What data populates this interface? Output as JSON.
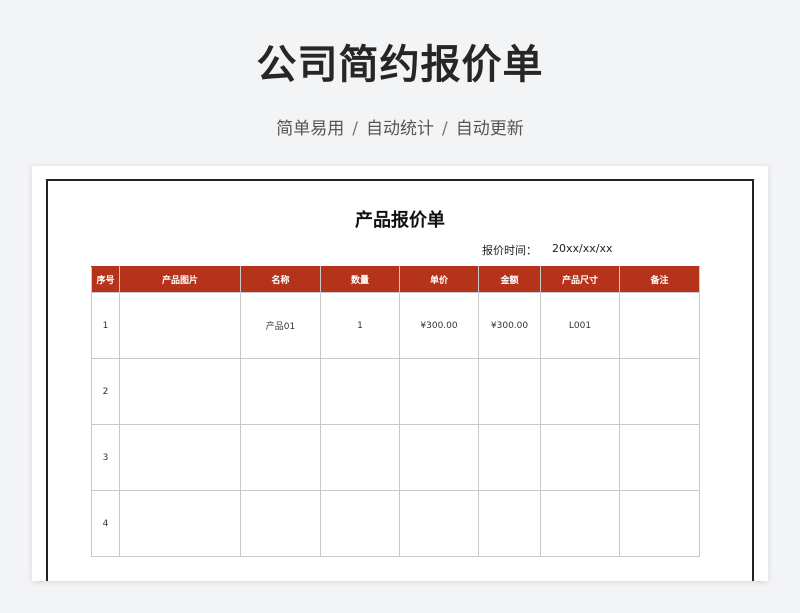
{
  "header": {
    "title": "公司简约报价单",
    "features": [
      "简单易用",
      "自动统计",
      "自动更新"
    ],
    "separator": "/"
  },
  "document": {
    "title": "产品报价单",
    "quote_time_label": "报价时间：",
    "quote_time_value": "20xx/xx/xx"
  },
  "table": {
    "columns": [
      "序号",
      "产品图片",
      "名称",
      "数量",
      "单价",
      "金额",
      "产品尺寸",
      "备注"
    ],
    "rows": [
      {
        "no": "1",
        "image": "",
        "name": "产品01",
        "qty": "1",
        "unit_price": "¥300.00",
        "amount": "¥300.00",
        "size": "L001",
        "note": ""
      },
      {
        "no": "2",
        "image": "",
        "name": "",
        "qty": "",
        "unit_price": "",
        "amount": "",
        "size": "",
        "note": ""
      },
      {
        "no": "3",
        "image": "",
        "name": "",
        "qty": "",
        "unit_price": "",
        "amount": "",
        "size": "",
        "note": ""
      },
      {
        "no": "4",
        "image": "",
        "name": "",
        "qty": "",
        "unit_price": "",
        "amount": "",
        "size": "",
        "note": ""
      }
    ]
  },
  "colors": {
    "header_bg": "#b5321b",
    "page_bg": "#f3f4f6"
  }
}
